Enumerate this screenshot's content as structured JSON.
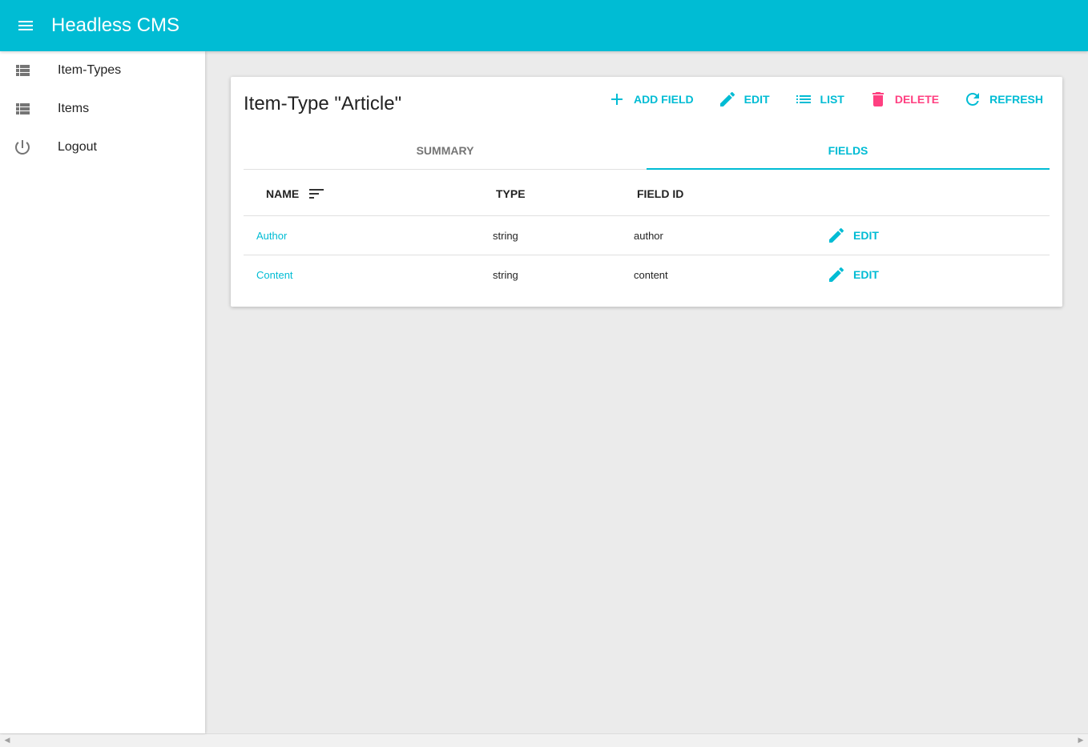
{
  "app": {
    "title": "Headless CMS"
  },
  "sidebar": {
    "items": [
      {
        "label": "Item-Types",
        "icon": "list-view-icon"
      },
      {
        "label": "Items",
        "icon": "list-view-icon"
      },
      {
        "label": "Logout",
        "icon": "power-icon"
      }
    ]
  },
  "card": {
    "title": "Item-Type \"Article\"",
    "actions": {
      "add_field": "ADD FIELD",
      "edit": "EDIT",
      "list": "LIST",
      "delete": "DELETE",
      "refresh": "REFRESH"
    },
    "tabs": [
      "SUMMARY",
      "FIELDS"
    ],
    "active_tab": "FIELDS"
  },
  "table": {
    "columns": [
      "NAME",
      "TYPE",
      "FIELD ID"
    ],
    "rows": [
      {
        "name": "Author",
        "type": "string",
        "field_id": "author",
        "action": "EDIT"
      },
      {
        "name": "Content",
        "type": "string",
        "field_id": "content",
        "action": "EDIT"
      }
    ]
  },
  "colors": {
    "primary": "#00bcd4",
    "accent": "#ff4081",
    "background": "#ebebeb"
  }
}
